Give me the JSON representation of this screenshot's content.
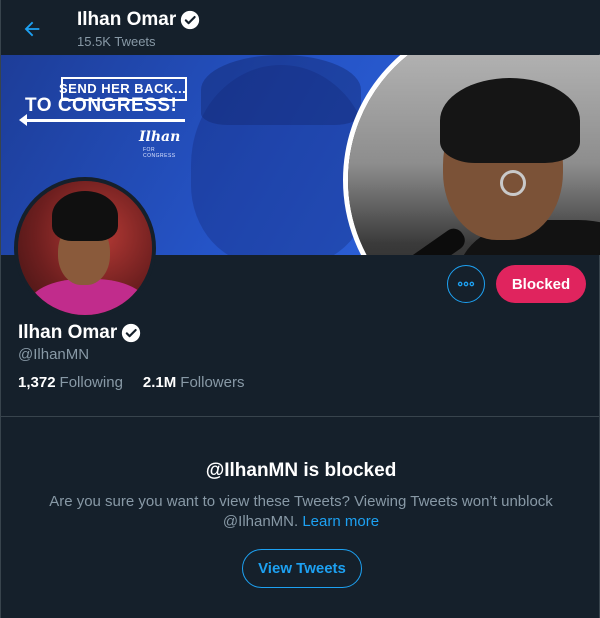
{
  "header": {
    "name": "Ilhan Omar",
    "tweet_count": "15.5K Tweets",
    "back_icon": "arrow-left-icon",
    "verified_icon": "verified-badge-icon"
  },
  "banner": {
    "sign_line1": "SEND HER BACK...",
    "sign_line2": "TO CONGRESS!",
    "sign_script": "Ilhan",
    "sign_sub": "FOR CONGRESS"
  },
  "profile": {
    "name": "Ilhan Omar",
    "handle": "@IlhanMN",
    "following_count": "1,372",
    "following_label": "Following",
    "followers_count": "2.1M",
    "followers_label": "Followers"
  },
  "actions": {
    "more_icon": "more-horizontal-icon",
    "blocked_label": "Blocked"
  },
  "blocked_notice": {
    "title": "@IlhanMN is blocked",
    "text": "Are you sure you want to view these Tweets? Viewing Tweets won’t unblock @IlhanMN.",
    "learn_more": "Learn more",
    "view_button": "View Tweets"
  },
  "colors": {
    "background": "#15202b",
    "accent": "#1da1f2",
    "blocked": "#e0245e",
    "secondary_text": "#8899a6",
    "border": "#38444d"
  }
}
